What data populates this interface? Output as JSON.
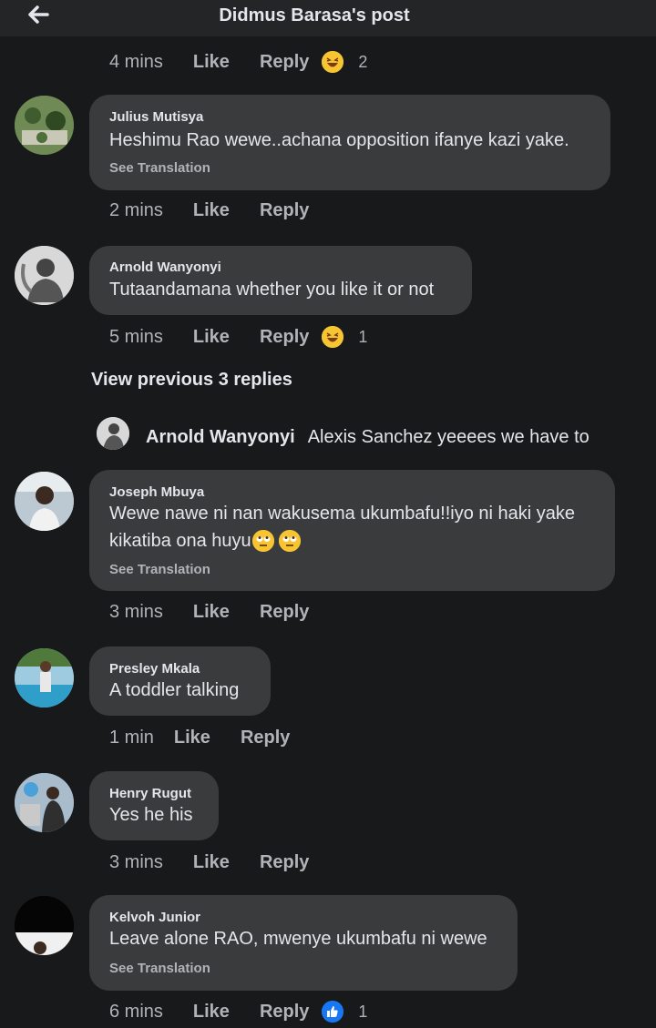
{
  "header": {
    "title": "Didmus Barasa's post"
  },
  "top_partial": {
    "time": "4 mins",
    "like": "Like",
    "reply": "Reply",
    "count": "2"
  },
  "comments": [
    {
      "author": "Julius Mutisya",
      "text": "Heshimu Rao wewe..achana opposition ifanye kazi yake.",
      "see_translation": "See Translation",
      "time": "2 mins",
      "like": "Like",
      "reply": "Reply"
    },
    {
      "author": "Arnold Wanyonyi",
      "text": "Tutaandamana whether you like it or not",
      "time": "5 mins",
      "like": "Like",
      "reply": "Reply",
      "reaction_count": "1"
    },
    {
      "author": "Joseph Mbuya",
      "text_line1": "Wewe nawe ni nan wakusema ukumbafu!!iyo ni haki yake",
      "text_line2": "kikatiba ona huyu",
      "see_translation": "See Translation",
      "time": "3 mins",
      "like": "Like",
      "reply": "Reply"
    },
    {
      "author": "Presley Mkala",
      "text": "A toddler talking",
      "time": "1 min",
      "like": "Like",
      "reply": "Reply"
    },
    {
      "author": "Henry Rugut",
      "text": "Yes he his",
      "time": "3 mins",
      "like": "Like",
      "reply": "Reply"
    },
    {
      "author": "Kelvoh Junior",
      "text": "Leave alone RAO, mwenye ukumbafu ni wewe",
      "see_translation": "See Translation",
      "time": "6 mins",
      "like": "Like",
      "reply": "Reply",
      "reaction_count": "1"
    }
  ],
  "view_previous": "View previous 3 replies",
  "reply_preview": {
    "author": "Arnold Wanyonyi",
    "text": "Alexis Sanchez yeeees we have to"
  },
  "colors": {
    "background": "#18191a",
    "bubble": "#3a3b3c",
    "secondary_text": "#b0b3b8",
    "like_blue": "#1877f2",
    "emoji_yellow": "#f7c531"
  }
}
